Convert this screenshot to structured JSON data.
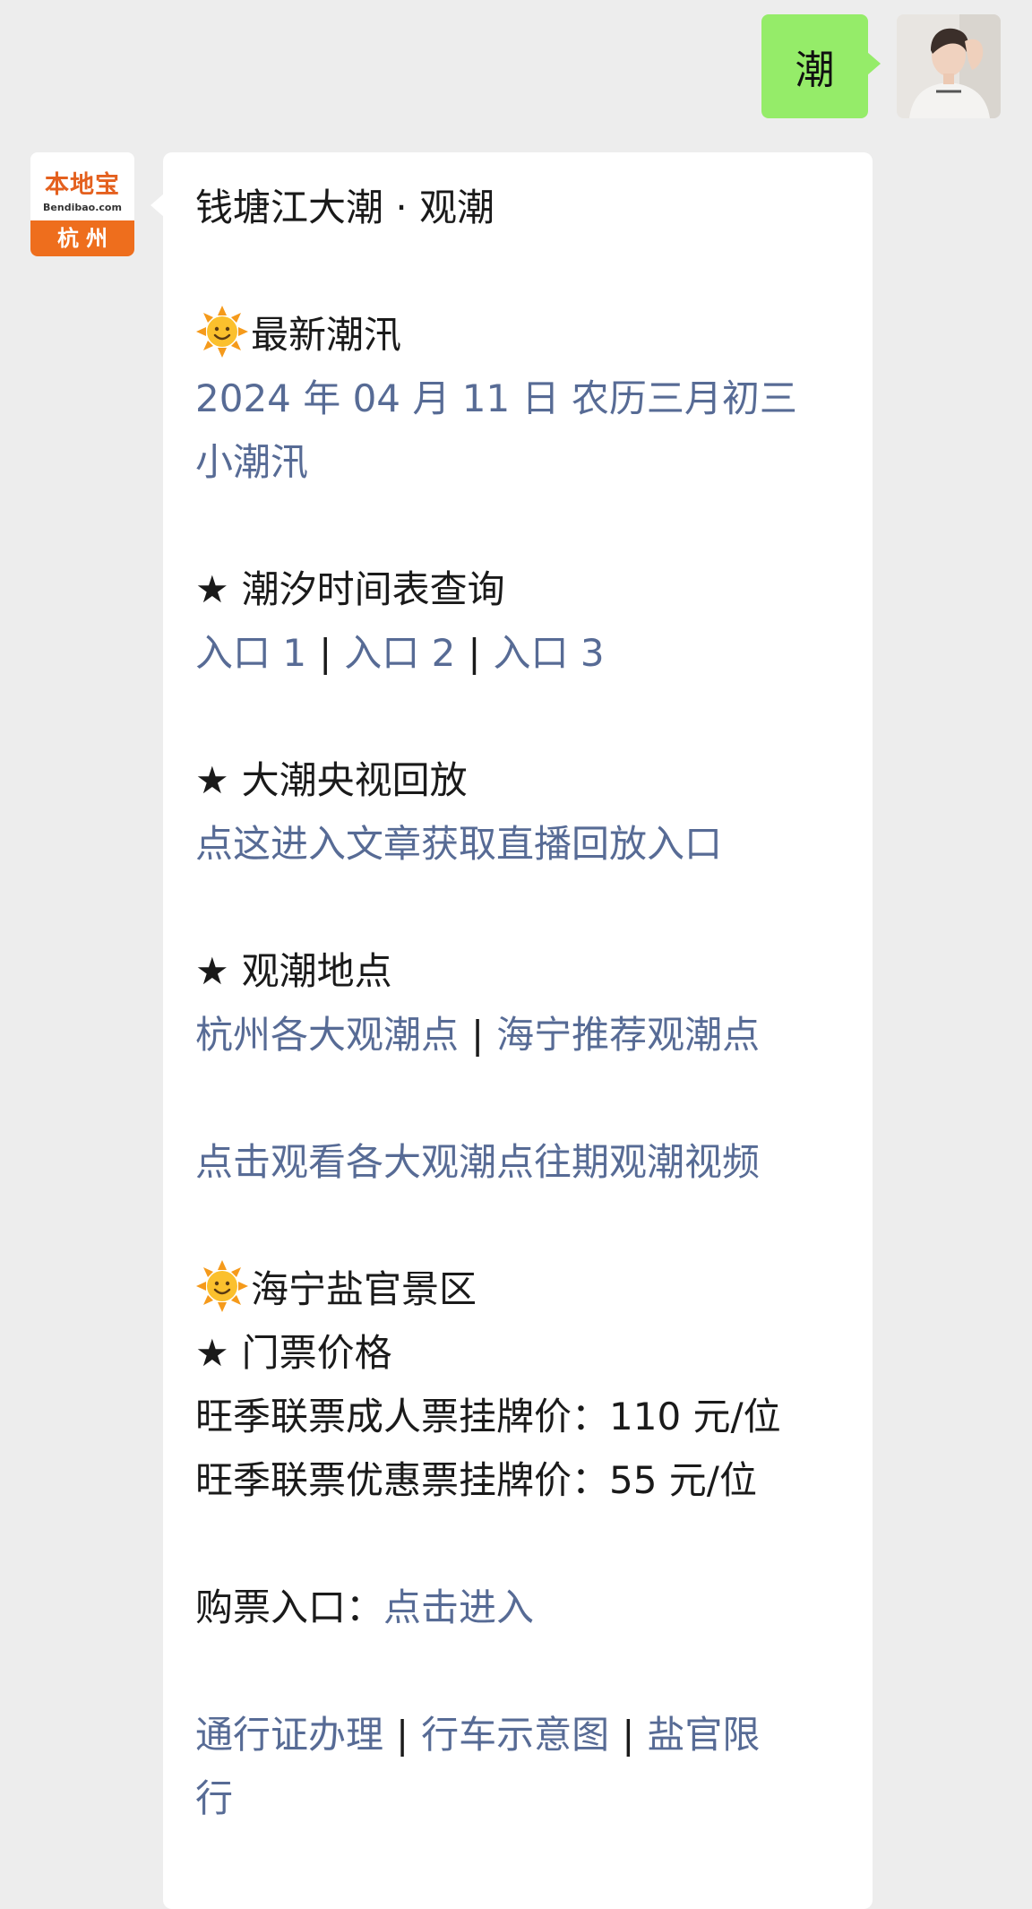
{
  "outgoing": {
    "text": "潮"
  },
  "incoming": {
    "avatar": {
      "brand": "本地宝",
      "domain": "Bendibao.com",
      "city": "杭州"
    },
    "title": "钱塘江大潮 · 观潮",
    "tide_section": {
      "icon": "sun-emoji-icon",
      "heading": "最新潮汛",
      "date": "2024 年 04 月 11 日  农历三月初三",
      "status": "小潮汛"
    },
    "timetable": {
      "heading": "潮汐时间表查询",
      "links": [
        "入口 1",
        "入口 2",
        "入口 3"
      ],
      "separator": "|"
    },
    "replay": {
      "heading": "大潮央视回放",
      "link": "点这进入文章获取直播回放入口"
    },
    "spots": {
      "heading": "观潮地点",
      "links": [
        "杭州各大观潮点",
        "海宁推荐观潮点"
      ]
    },
    "video_link": "点击观看各大观潮点往期观潮视频",
    "scenic": {
      "heading": "海宁盐官景区",
      "tickets_heading": "门票价格",
      "adult_price": "旺季联票成人票挂牌价：110 元/位",
      "discount_price": "旺季联票优惠票挂牌价：55 元/位",
      "purchase_label": "购票入口：",
      "purchase_link": "点击进入"
    },
    "footer_links": [
      "通行证办理",
      "行车示意图",
      "盐官限",
      "行"
    ],
    "star": "★"
  },
  "colors": {
    "link": "#576b95",
    "outgoing_bubble": "#95ec69",
    "brand_orange": "#ee6e1d"
  }
}
